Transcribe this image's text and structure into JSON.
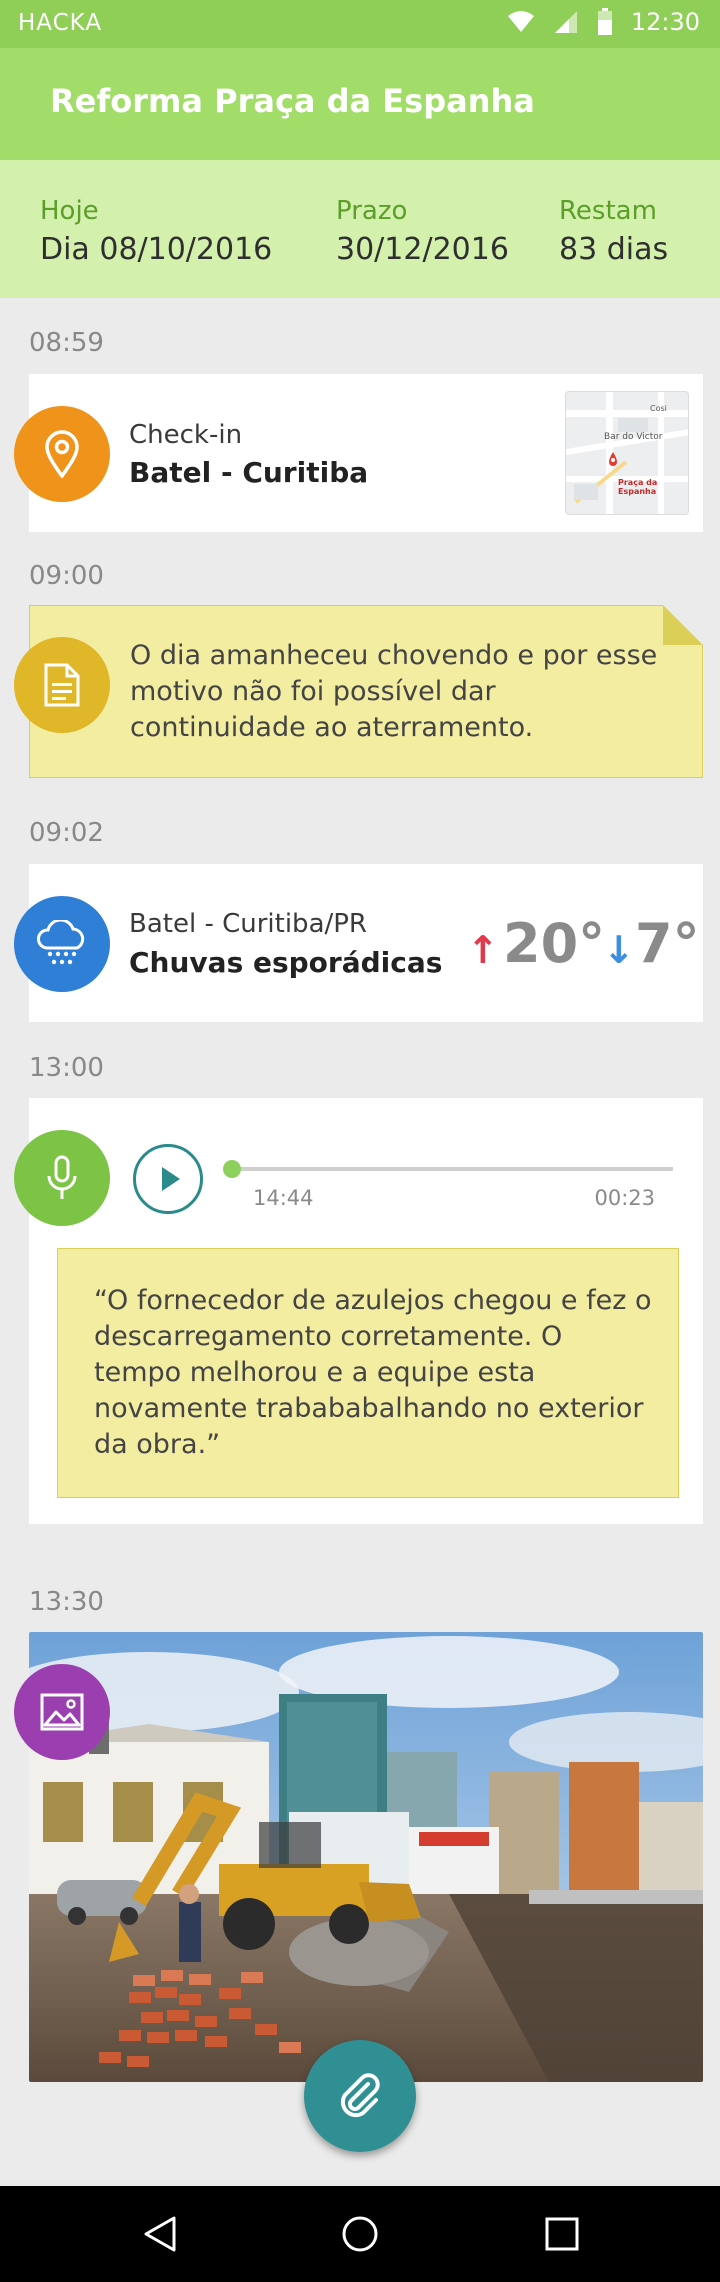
{
  "status_bar": {
    "carrier": "HACKA",
    "time": "12:30"
  },
  "app_bar": {
    "title": "Reforma Praça da Espanha"
  },
  "summary": {
    "today_label": "Hoje",
    "today_value": "Dia 08/10/2016",
    "deadline_label": "Prazo",
    "deadline_value": "30/12/2016",
    "remaining_label": "Restam",
    "remaining_value": "83 dias"
  },
  "entries": {
    "checkin": {
      "time": "08:59",
      "label": "Check-in",
      "place": "Batel - Curitiba",
      "map_pin_label": "Praça da Espanha",
      "map_poi": "Bar do Victor",
      "map_poi2": "Cosi"
    },
    "note": {
      "time": "09:00",
      "text": "O dia amanheceu chovendo e por esse motivo não foi possível dar continuidade ao aterramento."
    },
    "weather": {
      "time": "09:02",
      "location": "Batel - Curitiba/PR",
      "description": "Chuvas esporádicas",
      "max": "20°",
      "min": "7°"
    },
    "audio": {
      "time": "13:00",
      "start": "14:44",
      "duration": "00:23",
      "progress": 0,
      "transcript": "“O fornecedor de azulejos chegou e fez o descarregamento corretamente. O tempo melhorou e a equipe esta novamente trabababalhando no exterior da obra.”"
    },
    "photo": {
      "time": "13:30"
    }
  },
  "colors": {
    "brand": "#a2dd6a",
    "status": "#8fce57",
    "summary_bg": "#d3f0ad",
    "checkin": "#f0931b",
    "note": "#e0b729",
    "weather": "#2f7fd6",
    "audio": "#7cc346",
    "photo": "#9b3fb0",
    "fab": "#2f8f93",
    "temp_up": "#e0394a",
    "temp_down": "#3b8ee0"
  },
  "icons": [
    "wifi-icon",
    "signal-icon",
    "battery-icon",
    "location-pin-icon",
    "document-icon",
    "rain-cloud-icon",
    "microphone-icon",
    "play-icon",
    "image-icon",
    "paperclip-icon",
    "back-icon",
    "home-icon",
    "recents-icon"
  ]
}
